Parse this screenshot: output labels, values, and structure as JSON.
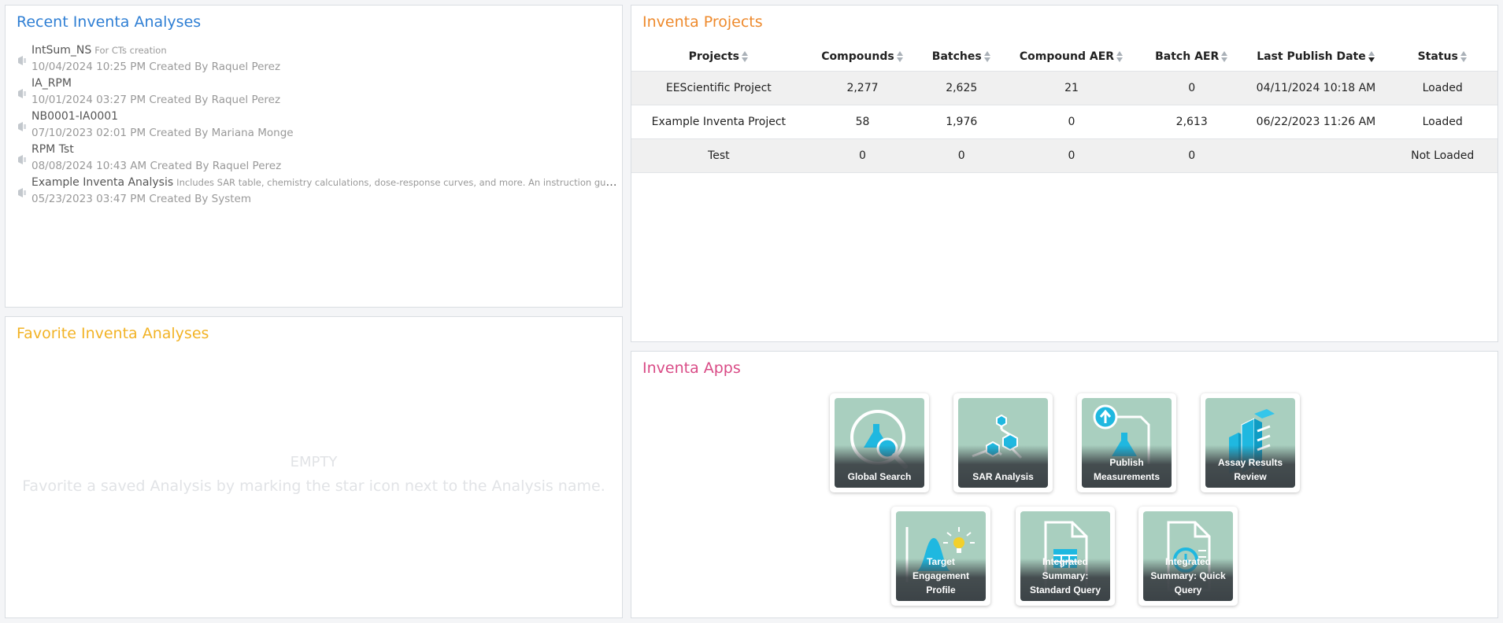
{
  "recent": {
    "title": "Recent Inventa Analyses",
    "items": [
      {
        "name": "IntSum_NS",
        "desc": "For CTs creation",
        "meta": "10/04/2024 10:25 PM Created By Raquel Perez"
      },
      {
        "name": "IA_RPM",
        "desc": "",
        "meta": "10/01/2024 03:27 PM Created By Raquel Perez"
      },
      {
        "name": "NB0001-IA0001",
        "desc": "",
        "meta": "07/10/2023 02:01 PM Created By Mariana Monge"
      },
      {
        "name": "RPM Tst",
        "desc": "",
        "meta": "08/08/2024 10:43 AM Created By Raquel Perez"
      },
      {
        "name": "Example Inventa Analysis",
        "desc": "Includes SAR table, chemistry calculations, dose-response curves, and more. An instruction guide to build ...",
        "meta": "05/23/2023 03:47 PM Created By System"
      }
    ]
  },
  "favorites": {
    "title": "Favorite Inventa Analyses",
    "empty_title": "EMPTY",
    "empty_message": "Favorite a saved Analysis by marking the star icon next to the Analysis name."
  },
  "projects": {
    "title": "Inventa Projects",
    "columns": [
      "Projects",
      "Compounds",
      "Batches",
      "Compound AER",
      "Batch AER",
      "Last Publish Date",
      "Status"
    ],
    "rows": [
      {
        "project": "EEScientific Project",
        "compounds": "2,277",
        "batches": "2,625",
        "compound_aer": "21",
        "batch_aer": "0",
        "last_publish": "04/11/2024 10:18 AM",
        "status": "Loaded"
      },
      {
        "project": "Example Inventa Project",
        "compounds": "58",
        "batches": "1,976",
        "compound_aer": "0",
        "batch_aer": "2,613",
        "last_publish": "06/22/2023 11:26 AM",
        "status": "Loaded"
      },
      {
        "project": "Test",
        "compounds": "0",
        "batches": "0",
        "compound_aer": "0",
        "batch_aer": "0",
        "last_publish": "",
        "status": "Not Loaded"
      }
    ]
  },
  "apps": {
    "title": "Inventa Apps",
    "tiles": [
      {
        "label": "Global Search",
        "icon": "magnifier-flask-icon"
      },
      {
        "label": "SAR Analysis",
        "icon": "molecule-icon"
      },
      {
        "label": "Publish Measurements",
        "icon": "upload-flask-icon"
      },
      {
        "label": "Assay Results Review",
        "icon": "bar-blocks-icon"
      },
      {
        "label": "Target Engagement Profile",
        "icon": "curve-bulb-icon"
      },
      {
        "label": "Integrated Summary: Standard Query",
        "icon": "document-table-icon"
      },
      {
        "label": "Integrated Summary: Quick Query",
        "icon": "document-clock-icon"
      }
    ]
  },
  "colors": {
    "recent_title": "#2f7fd4",
    "favorites_title": "#f2b326",
    "projects_title": "#ee8a2d",
    "apps_title": "#d94b86",
    "status_loaded": "#3a9a5c",
    "status_not_loaded": "#f2a52b",
    "tile_background": "#a9cfbf",
    "tile_icon": "#1fb8e0"
  }
}
